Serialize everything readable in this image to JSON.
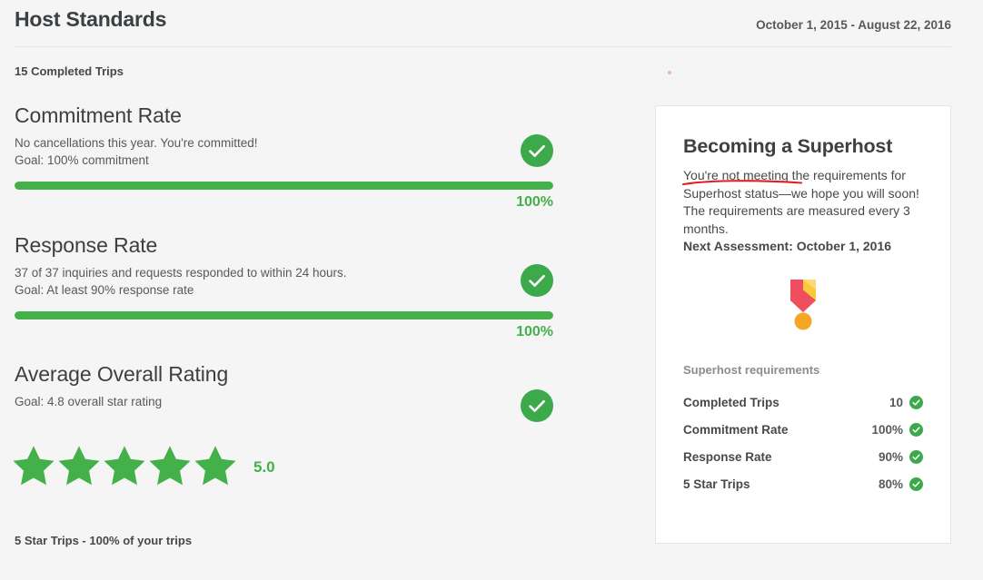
{
  "header": {
    "title": "Host Standards",
    "date_range": "October 1, 2015 - August 22, 2016",
    "completed_trips": "15 Completed Trips"
  },
  "colors": {
    "green": "#44b04a",
    "badge_green": "#3ca94b",
    "background": "#f5f5f5",
    "card_background": "#ffffff",
    "annotation_red": "#e02020",
    "medal_red": "#ef4e5e",
    "medal_yellow": "#f8c93c",
    "medal_orange": "#f5a623"
  },
  "metrics": [
    {
      "title": "Commitment Rate",
      "description": "No cancellations this year. You're committed!",
      "goal": "Goal: 100% commitment",
      "progress_label": "100%",
      "progress_percent": 100,
      "status_icon": "check-circle-icon"
    },
    {
      "title": "Response Rate",
      "description": "37 of 37 inquiries and requests responded to within 24 hours.",
      "goal": "Goal: At least 90% response rate",
      "progress_label": "100%",
      "progress_percent": 100,
      "status_icon": "check-circle-icon"
    },
    {
      "title": "Average Overall Rating",
      "description": "",
      "goal": "Goal: 4.8 overall star rating",
      "progress_label": "",
      "progress_percent": null,
      "status_icon": "check-circle-icon"
    }
  ],
  "rating": {
    "stars_filled": 5,
    "value": "5.0",
    "star_icon": "star-icon"
  },
  "five_star_trips": "5 Star Trips - 100% of your trips",
  "superhost_card": {
    "title": "Becoming a Superhost",
    "body": "You're not meeting the requirements for Superhost status—we hope you will soon! The requirements are measured every 3 months.",
    "next_assessment": "Next Assessment: October 1, 2016",
    "annotation": "red-underline-annotation",
    "medal_icon": "medal-icon",
    "requirements_heading": "Superhost requirements",
    "requirements": [
      {
        "label": "Completed Trips",
        "value": "10",
        "icon": "check-circle-icon"
      },
      {
        "label": "Commitment Rate",
        "value": "100%",
        "icon": "check-circle-icon"
      },
      {
        "label": "Response Rate",
        "value": "90%",
        "icon": "check-circle-icon"
      },
      {
        "label": "5 Star Trips",
        "value": "80%",
        "icon": "check-circle-icon"
      }
    ]
  }
}
